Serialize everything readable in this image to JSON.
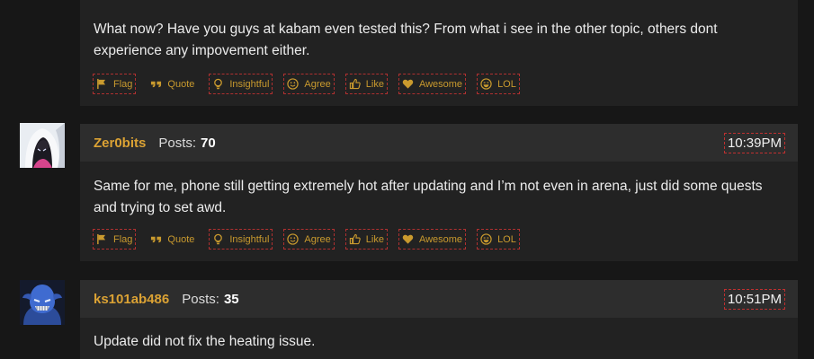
{
  "reaction_labels": {
    "flag": "Flag",
    "quote": "Quote",
    "insightful": "Insightful",
    "agree": "Agree",
    "like": "Like",
    "awesome": "Awesome",
    "lol": "LOL"
  },
  "posts": [
    {
      "text": "What now? Have you guys at kabam even tested this? From what i see in the other topic, others dont experience any impovement either."
    },
    {
      "author": "Zer0bits",
      "posts_label": "Posts:",
      "posts_count": "70",
      "time": "10:39PM",
      "text": "Same for me, phone still getting extremely hot after updating and I’m not even in arena, just did some quests and trying to set awd."
    },
    {
      "author": "ks101ab486",
      "posts_label": "Posts:",
      "posts_count": "35",
      "time": "10:51PM",
      "text": "Update did not fix the heating issue."
    }
  ],
  "colors": {
    "accent": "#dba234",
    "reaction": "#c99a2e",
    "post_bg": "#222222",
    "header_bg": "#2d2d2d",
    "page_bg": "#171717"
  },
  "icons": {
    "flag": "flag-icon",
    "quote": "quote-icon",
    "insightful": "lightbulb-icon",
    "agree": "smiley-icon",
    "like": "thumbs-up-icon",
    "awesome": "heart-icon",
    "lol": "laugh-icon"
  }
}
